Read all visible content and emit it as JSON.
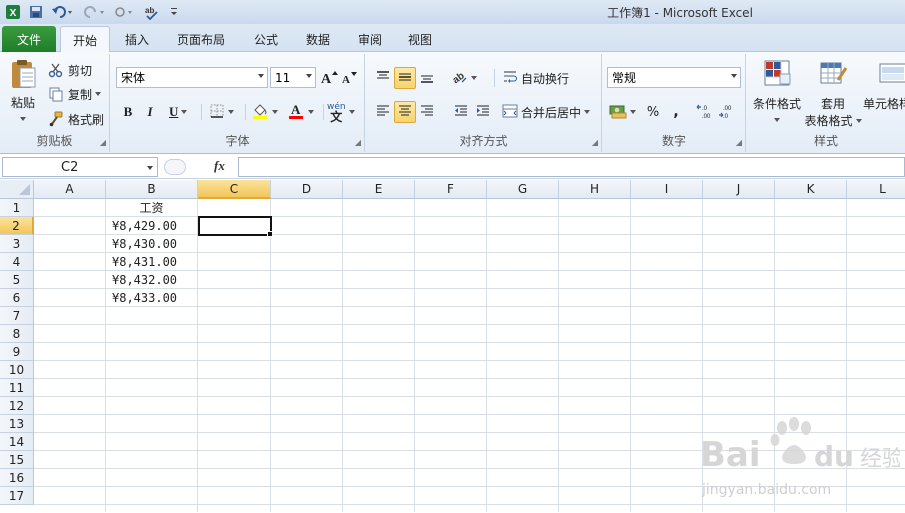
{
  "app": {
    "title": "工作簿1 - Microsoft Excel"
  },
  "tabs": {
    "file": "文件",
    "items": [
      "开始",
      "插入",
      "页面布局",
      "公式",
      "数据",
      "审阅",
      "视图"
    ],
    "active": "开始"
  },
  "ribbon": {
    "clipboard": {
      "paste": "粘贴",
      "cut": "剪切",
      "copy": "复制",
      "format_painter": "格式刷",
      "label": "剪贴板"
    },
    "font": {
      "family": "宋体",
      "size": "11",
      "bold": "B",
      "italic": "I",
      "underline": "U",
      "phonetic": "wén",
      "label": "字体"
    },
    "alignment": {
      "wrap_text": "自动换行",
      "merge_center": "合并后居中",
      "label": "对齐方式"
    },
    "number": {
      "format": "常规",
      "percent": "%",
      "comma": ",",
      "label": "数字"
    },
    "styles": {
      "conditional": "条件格式",
      "table_line1": "套用",
      "table_line2": "表格格式",
      "cell_styles": "单元格样",
      "label": "样式"
    }
  },
  "formula_bar": {
    "name_box": "C2",
    "fx": "fx",
    "content": ""
  },
  "sheet": {
    "columns": [
      "A",
      "B",
      "C",
      "D",
      "E",
      "F",
      "G",
      "H",
      "I",
      "J",
      "K",
      "L"
    ],
    "rows": [
      "1",
      "2",
      "3",
      "4",
      "5",
      "6",
      "7",
      "8",
      "9",
      "10",
      "11",
      "12",
      "13",
      "14",
      "15",
      "16",
      "17"
    ],
    "cells": {
      "B1": "工资",
      "B2": "¥8,429.00",
      "B3": "¥8,430.00",
      "B4": "¥8,431.00",
      "B5": "¥8,432.00",
      "B6": "¥8,433.00"
    },
    "active_cell": "C2"
  },
  "watermark": {
    "brand": "Bai 经验",
    "url": "jingyan.baidu.com"
  }
}
